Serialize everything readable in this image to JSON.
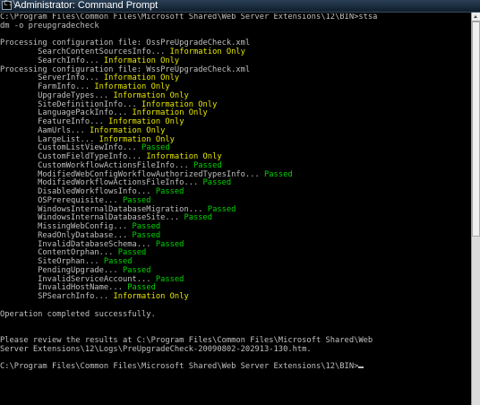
{
  "window": {
    "title": "Administrator: Command Prompt",
    "icon": "cmd-icon"
  },
  "console": {
    "lines": [
      {
        "segments": [
          {
            "text": "C:\\Program Files\\Common Files\\Microsoft Shared\\Web Server Extensions\\12\\BIN>stsa",
            "color": "default"
          }
        ]
      },
      {
        "segments": [
          {
            "text": "dm -o preupgradecheck",
            "color": "default"
          }
        ]
      },
      {
        "segments": []
      },
      {
        "segments": [
          {
            "text": "Processing configuration file: OssPreUpgradeCheck.xml",
            "color": "default"
          }
        ]
      },
      {
        "segments": [
          {
            "text": "        SearchContentSourcesInfo... ",
            "color": "default"
          },
          {
            "text": "Information Only",
            "color": "yellow"
          }
        ]
      },
      {
        "segments": [
          {
            "text": "        SearchInfo... ",
            "color": "default"
          },
          {
            "text": "Information Only",
            "color": "yellow"
          }
        ]
      },
      {
        "segments": [
          {
            "text": "Processing configuration file: WssPreUpgradeCheck.xml",
            "color": "default"
          }
        ]
      },
      {
        "segments": [
          {
            "text": "        ServerInfo... ",
            "color": "default"
          },
          {
            "text": "Information Only",
            "color": "yellow"
          }
        ]
      },
      {
        "segments": [
          {
            "text": "        FarmInfo... ",
            "color": "default"
          },
          {
            "text": "Information Only",
            "color": "yellow"
          }
        ]
      },
      {
        "segments": [
          {
            "text": "        UpgradeTypes... ",
            "color": "default"
          },
          {
            "text": "Information Only",
            "color": "yellow"
          }
        ]
      },
      {
        "segments": [
          {
            "text": "        SiteDefinitionInfo... ",
            "color": "default"
          },
          {
            "text": "Information Only",
            "color": "yellow"
          }
        ]
      },
      {
        "segments": [
          {
            "text": "        LanguagePackInfo... ",
            "color": "default"
          },
          {
            "text": "Information Only",
            "color": "yellow"
          }
        ]
      },
      {
        "segments": [
          {
            "text": "        FeatureInfo... ",
            "color": "default"
          },
          {
            "text": "Information Only",
            "color": "yellow"
          }
        ]
      },
      {
        "segments": [
          {
            "text": "        AamUrls... ",
            "color": "default"
          },
          {
            "text": "Information Only",
            "color": "yellow"
          }
        ]
      },
      {
        "segments": [
          {
            "text": "        LargeList... ",
            "color": "default"
          },
          {
            "text": "Information Only",
            "color": "yellow"
          }
        ]
      },
      {
        "segments": [
          {
            "text": "        CustomListViewInfo... ",
            "color": "default"
          },
          {
            "text": "Passed",
            "color": "green"
          }
        ]
      },
      {
        "segments": [
          {
            "text": "        CustomFieldTypeInfo... ",
            "color": "default"
          },
          {
            "text": "Information Only",
            "color": "yellow"
          }
        ]
      },
      {
        "segments": [
          {
            "text": "        CustomWorkflowActionsFileInfo... ",
            "color": "default"
          },
          {
            "text": "Passed",
            "color": "green"
          }
        ]
      },
      {
        "segments": [
          {
            "text": "        ModifiedWebConfigWorkflowAuthorizedTypesInfo... ",
            "color": "default"
          },
          {
            "text": "Passed",
            "color": "green"
          }
        ]
      },
      {
        "segments": [
          {
            "text": "        ModifiedWorkflowActionsFileInfo... ",
            "color": "default"
          },
          {
            "text": "Passed",
            "color": "green"
          }
        ]
      },
      {
        "segments": [
          {
            "text": "        DisabledWorkflowsInfo... ",
            "color": "default"
          },
          {
            "text": "Passed",
            "color": "green"
          }
        ]
      },
      {
        "segments": [
          {
            "text": "        OSPrerequisite... ",
            "color": "default"
          },
          {
            "text": "Passed",
            "color": "green"
          }
        ]
      },
      {
        "segments": [
          {
            "text": "        WindowsInternalDatabaseMigration... ",
            "color": "default"
          },
          {
            "text": "Passed",
            "color": "green"
          }
        ]
      },
      {
        "segments": [
          {
            "text": "        WindowsInternalDatabaseSite... ",
            "color": "default"
          },
          {
            "text": "Passed",
            "color": "green"
          }
        ]
      },
      {
        "segments": [
          {
            "text": "        MissingWebConfig... ",
            "color": "default"
          },
          {
            "text": "Passed",
            "color": "green"
          }
        ]
      },
      {
        "segments": [
          {
            "text": "        ReadOnlyDatabase... ",
            "color": "default"
          },
          {
            "text": "Passed",
            "color": "green"
          }
        ]
      },
      {
        "segments": [
          {
            "text": "        InvalidDatabaseSchema... ",
            "color": "default"
          },
          {
            "text": "Passed",
            "color": "green"
          }
        ]
      },
      {
        "segments": [
          {
            "text": "        ContentOrphan... ",
            "color": "default"
          },
          {
            "text": "Passed",
            "color": "green"
          }
        ]
      },
      {
        "segments": [
          {
            "text": "        SiteOrphan... ",
            "color": "default"
          },
          {
            "text": "Passed",
            "color": "green"
          }
        ]
      },
      {
        "segments": [
          {
            "text": "        PendingUpgrade... ",
            "color": "default"
          },
          {
            "text": "Passed",
            "color": "green"
          }
        ]
      },
      {
        "segments": [
          {
            "text": "        InvalidServiceAccount... ",
            "color": "default"
          },
          {
            "text": "Passed",
            "color": "green"
          }
        ]
      },
      {
        "segments": [
          {
            "text": "        InvalidHostName... ",
            "color": "default"
          },
          {
            "text": "Passed",
            "color": "green"
          }
        ]
      },
      {
        "segments": [
          {
            "text": "        SPSearchInfo... ",
            "color": "default"
          },
          {
            "text": "Information Only",
            "color": "yellow"
          }
        ]
      },
      {
        "segments": []
      },
      {
        "segments": [
          {
            "text": "Operation completed successfully.",
            "color": "default"
          }
        ]
      },
      {
        "segments": []
      },
      {
        "segments": []
      },
      {
        "segments": [
          {
            "text": "Please review the results at C:\\Program Files\\Common Files\\Microsoft Shared\\Web",
            "color": "default"
          }
        ]
      },
      {
        "segments": [
          {
            "text": "Server Extensions\\12\\Logs\\PreUpgradeCheck-20090802-202913-130.htm.",
            "color": "default"
          }
        ]
      },
      {
        "segments": []
      },
      {
        "segments": [
          {
            "text": "C:\\Program Files\\Common Files\\Microsoft Shared\\Web Server Extensions\\12\\BIN>",
            "color": "default"
          }
        ],
        "cursor": true
      }
    ]
  },
  "colors": {
    "background": "#000000",
    "default_text": "#c0c0c0",
    "passed": "#00d600",
    "information_only": "#e6e600"
  }
}
